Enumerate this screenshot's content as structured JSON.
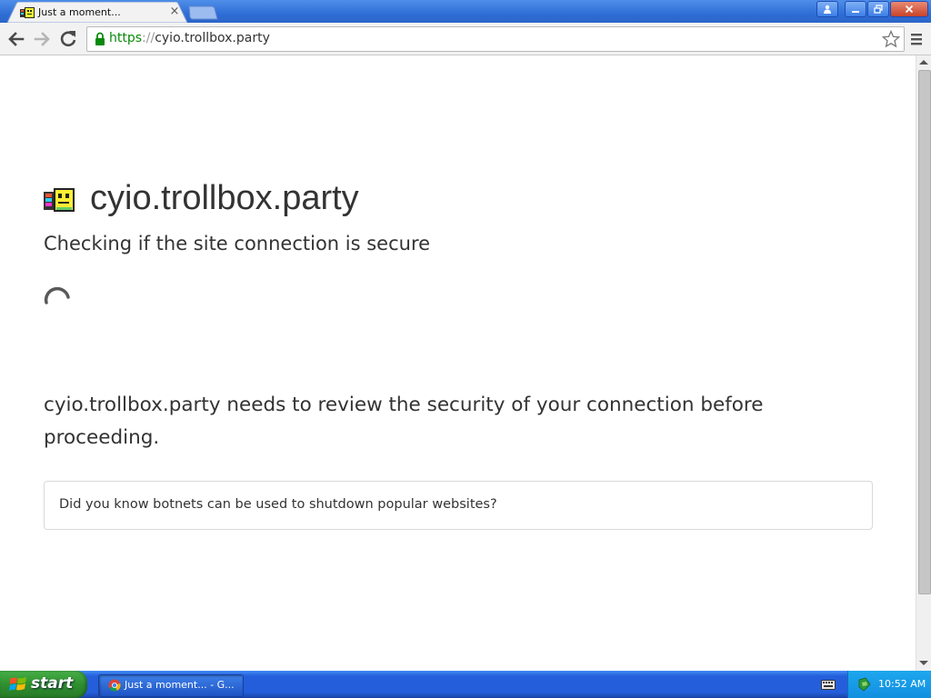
{
  "browser": {
    "tab": {
      "title": "Just a moment...",
      "close_glyph": "×"
    },
    "window_controls": {
      "profile_glyph": "⛄",
      "minimize_glyph": "—",
      "restore_glyph": "❐",
      "close_glyph": "✕"
    },
    "address_bar": {
      "scheme": "https",
      "separator": "://",
      "host": "cyio.trollbox.party"
    },
    "icons": {
      "back": "back-arrow-icon",
      "forward": "forward-arrow-icon",
      "reload": "reload-icon",
      "lock": "lock-icon",
      "bookmark": "star-icon",
      "menu": "hamburger-menu-icon"
    }
  },
  "page": {
    "site_name": "cyio.trollbox.party",
    "heading": "Checking if the site connection is secure",
    "message": "cyio.trollbox.party needs to review the security of your connection before proceeding.",
    "tip": "Did you know botnets can be used to shutdown popular websites?"
  },
  "taskbar": {
    "start_label": "start",
    "window_item": "Just a moment... - G...",
    "clock": "10:52 AM"
  },
  "colors": {
    "title_bar": "#2f6fd6",
    "secure_scheme": "#0a8a0a",
    "text": "#333333",
    "taskbar": "#245edb",
    "start_button": "#2f8f2f",
    "tray": "#128fe0"
  }
}
